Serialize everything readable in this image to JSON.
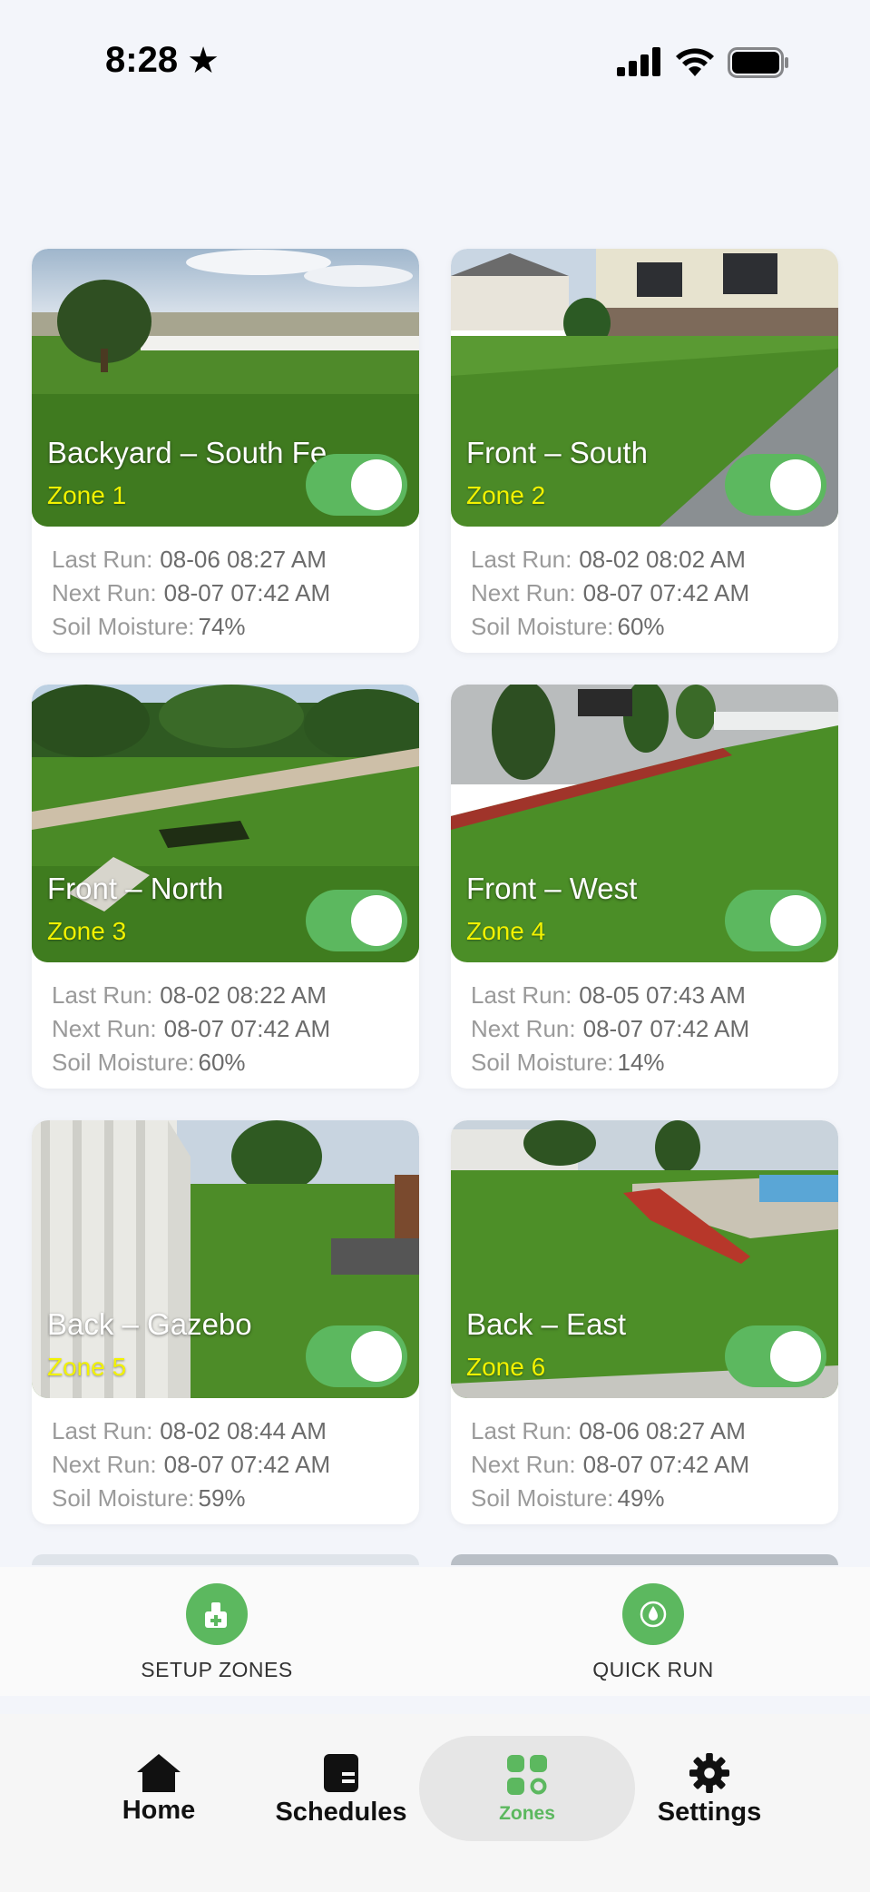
{
  "status_bar": {
    "time": "8:28"
  },
  "zones": [
    {
      "name": "Backyard – South Fe",
      "zone": "Zone 1",
      "last_run_label": "Last Run:",
      "last_run": "08-06 08:27 AM",
      "next_run_label": "Next Run:",
      "next_run": "08-07 07:42 AM",
      "soil_label": "Soil Moisture:",
      "soil": "74%",
      "enabled": true
    },
    {
      "name": "Front – South",
      "zone": "Zone 2",
      "last_run_label": "Last Run:",
      "last_run": "08-02 08:02 AM",
      "next_run_label": "Next Run:",
      "next_run": "08-07 07:42 AM",
      "soil_label": "Soil Moisture:",
      "soil": "60%",
      "enabled": true
    },
    {
      "name": "Front – North",
      "zone": "Zone 3",
      "last_run_label": "Last Run:",
      "last_run": "08-02 08:22 AM",
      "next_run_label": "Next Run:",
      "next_run": "08-07 07:42 AM",
      "soil_label": "Soil Moisture:",
      "soil": "60%",
      "enabled": true
    },
    {
      "name": "Front – West",
      "zone": "Zone 4",
      "last_run_label": "Last Run:",
      "last_run": "08-05 07:43 AM",
      "next_run_label": "Next Run:",
      "next_run": "08-07 07:42 AM",
      "soil_label": "Soil Moisture:",
      "soil": "14%",
      "enabled": true
    },
    {
      "name": "Back – Gazebo",
      "zone": "Zone 5",
      "last_run_label": "Last Run:",
      "last_run": "08-02 08:44 AM",
      "next_run_label": "Next Run:",
      "next_run": "08-07 07:42 AM",
      "soil_label": "Soil Moisture:",
      "soil": "59%",
      "enabled": true
    },
    {
      "name": "Back – East",
      "zone": "Zone 6",
      "last_run_label": "Last Run:",
      "last_run": "08-06 08:27 AM",
      "next_run_label": "Next Run:",
      "next_run": "08-07 07:42 AM",
      "soil_label": "Soil Moisture:",
      "soil": "49%",
      "enabled": true
    }
  ],
  "actions": {
    "setup_zones": {
      "label": "SETUP ZONES",
      "icon": "sprinkler-plus-icon"
    },
    "quick_run": {
      "label": "QUICK RUN",
      "icon": "water-drop-icon"
    }
  },
  "nav": {
    "home": {
      "label": "Home",
      "icon": "house-icon"
    },
    "schedules": {
      "label": "Schedules",
      "icon": "calendar-icon"
    },
    "zones": {
      "label": "Zones",
      "icon": "grid-icon",
      "active": true
    },
    "settings": {
      "label": "Settings",
      "icon": "gear-icon"
    }
  },
  "colors": {
    "accent": "#5cb85f",
    "zone_label": "#f2f200",
    "background": "#f3f5fa"
  }
}
